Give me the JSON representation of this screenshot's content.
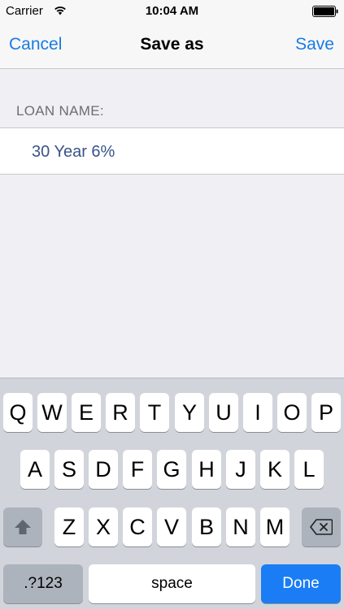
{
  "status_bar": {
    "carrier": "Carrier",
    "time": "10:04 AM"
  },
  "nav": {
    "cancel_label": "Cancel",
    "title": "Save as",
    "save_label": "Save"
  },
  "form": {
    "section_header": "LOAN NAME:",
    "loan_name_value": "30 Year 6%"
  },
  "keyboard": {
    "row1": [
      "Q",
      "W",
      "E",
      "R",
      "T",
      "Y",
      "U",
      "I",
      "O",
      "P"
    ],
    "row2": [
      "A",
      "S",
      "D",
      "F",
      "G",
      "H",
      "J",
      "K",
      "L"
    ],
    "row3": [
      "Z",
      "X",
      "C",
      "V",
      "B",
      "N",
      "M"
    ],
    "numbers_label": ".?123",
    "space_label": "space",
    "done_label": "Done"
  },
  "colors": {
    "accent": "#1a7ce0",
    "done_key": "#1a7df5",
    "field_text": "#385487"
  }
}
